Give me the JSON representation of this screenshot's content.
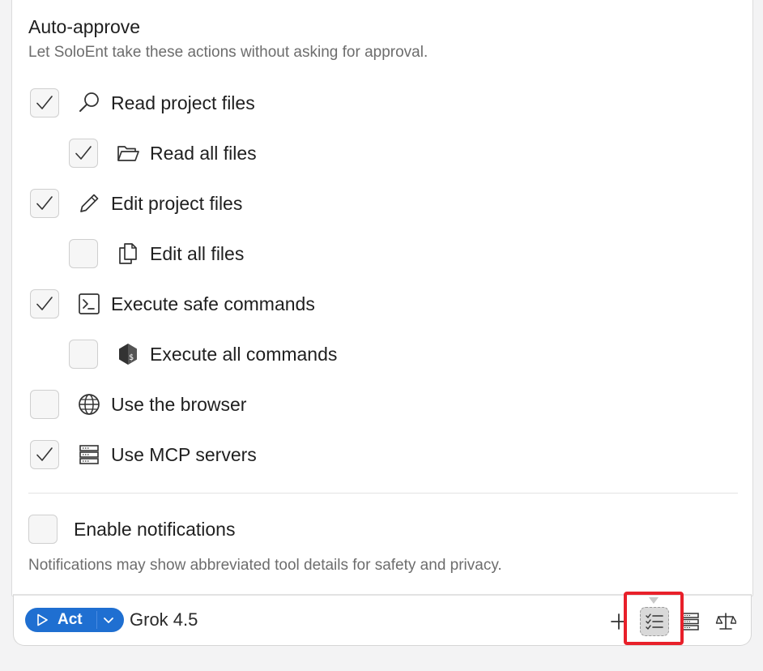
{
  "panel": {
    "title": "Auto-approve",
    "subtitle": "Let SoloEnt take these actions without asking for approval."
  },
  "options": [
    {
      "label": "Read project files",
      "checked": true,
      "icon": "search-icon"
    },
    {
      "label": "Read all files",
      "checked": true,
      "icon": "folder-open-icon"
    },
    {
      "label": "Edit project files",
      "checked": true,
      "icon": "pencil-icon"
    },
    {
      "label": "Edit all files",
      "checked": false,
      "icon": "copy-files-icon"
    },
    {
      "label": "Execute safe commands",
      "checked": true,
      "icon": "terminal-icon"
    },
    {
      "label": "Execute all commands",
      "checked": false,
      "icon": "shell-script-icon"
    },
    {
      "label": "Use the browser",
      "checked": false,
      "icon": "globe-icon"
    },
    {
      "label": "Use MCP servers",
      "checked": true,
      "icon": "server-icon"
    }
  ],
  "notifications": {
    "label": "Enable notifications",
    "checked": false,
    "note": "Notifications may show abbreviated tool details for safety and privacy."
  },
  "toolbar": {
    "mode_label": "Act",
    "model_label": "Grok 4.5",
    "tools": [
      "plus-icon",
      "checklist-icon",
      "server-list-icon",
      "scale-icon"
    ],
    "active_tool": "checklist-icon"
  },
  "colors": {
    "accent": "#1f6fd1",
    "highlight": "#e8202a",
    "muted_text": "#6d6d6d"
  }
}
